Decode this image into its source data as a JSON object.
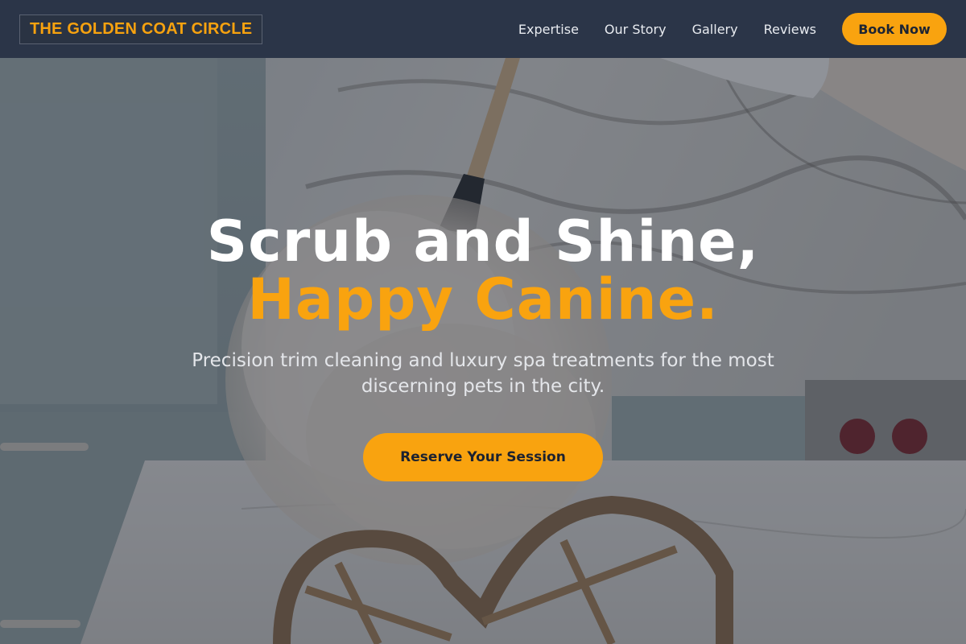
{
  "brand": {
    "name": "THE GOLDEN COAT CIRCLE",
    "accent_color": "#f9a30f",
    "header_color": "#2b3548"
  },
  "nav": {
    "links": [
      "Expertise",
      "Our Story",
      "Gallery",
      "Reviews"
    ],
    "book_label": "Book Now"
  },
  "hero": {
    "headline_line1": "Scrub and Shine,",
    "headline_line2": "Happy Canine.",
    "subtitle": "Precision trim cleaning and luxury spa treatments for the most discerning pets in the city.",
    "cta_label": "Reserve Your Session",
    "background_image": "feather-duster-on-wicker-chair-in-marble-kitchen"
  }
}
